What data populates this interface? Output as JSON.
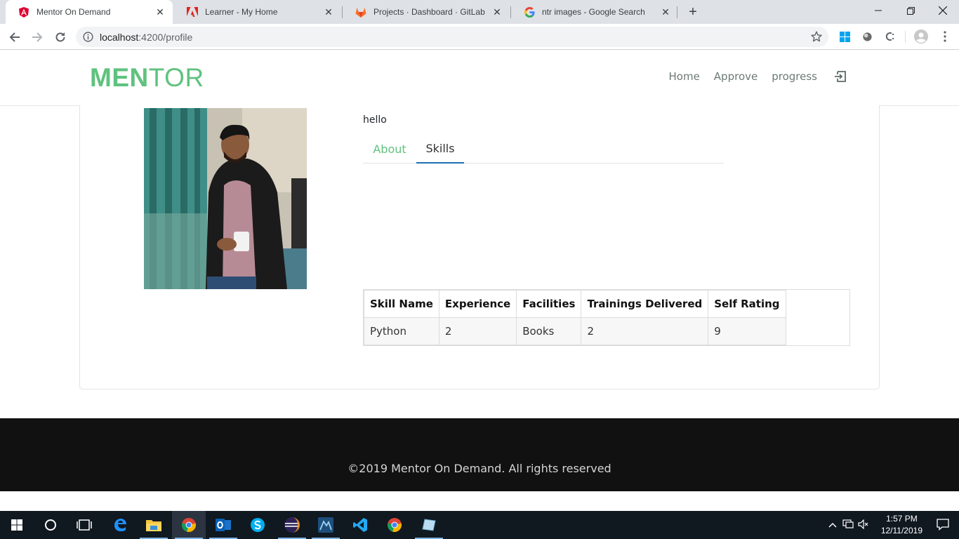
{
  "browser": {
    "tabs": [
      {
        "title": "Mentor On Demand",
        "icon": "angular-icon",
        "active": true
      },
      {
        "title": "Learner - My Home",
        "icon": "adobe-icon",
        "active": false
      },
      {
        "title": "Projects · Dashboard · GitLab",
        "icon": "gitlab-icon",
        "active": false
      },
      {
        "title": "ntr images - Google Search",
        "icon": "google-icon",
        "active": false
      }
    ],
    "address": {
      "host": "localhost",
      "rest": ":4200/profile"
    }
  },
  "app": {
    "logo_bold": "MEN",
    "logo_light": "TOR",
    "nav": {
      "home": "Home",
      "approve": "Approve",
      "progress": "progress"
    },
    "brand_color": "#5fc27e"
  },
  "profile": {
    "greeting": "hello",
    "tabs": {
      "about": "About",
      "skills": "Skills"
    },
    "active_tab": "Skills",
    "skills_table": {
      "headers": [
        "Skill Name",
        "Experience",
        "Facilities",
        "Trainings Delivered",
        "Self Rating"
      ],
      "rows": [
        [
          "Python",
          "2",
          "Books",
          "2",
          "9"
        ]
      ]
    }
  },
  "footer": {
    "copyright": "©2019 Mentor On Demand. All rights reserved"
  },
  "taskbar": {
    "time": "1:57 PM",
    "date": "12/11/2019"
  }
}
